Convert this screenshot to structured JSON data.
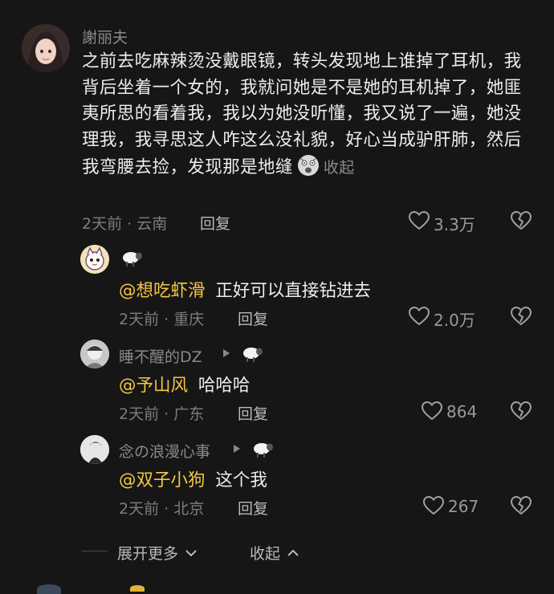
{
  "main_comment": {
    "author": "謝丽夫",
    "text": "之前去吃麻辣烫没戴眼镜，转头发现地上谁掉了耳机，我背后坐着一个女的，我就问她是不是她的耳机掉了，她匪夷所思的看着我，我以为她没听懂，我又说了一遍，她没理我，我寻思这人咋这么没礼貌，好心当成驴肝肺，然后我弯腰去捡，发现那是地缝",
    "collapse_label": "收起",
    "time_location": "2天前 · 云南",
    "reply_label": "回复",
    "likes": "3.3万",
    "emoji_icon": "shocked-face-icon"
  },
  "replies": [
    {
      "author": "",
      "badge_icon": "sheep-icon",
      "show_arrow": false,
      "mention": "@想吃虾滑",
      "text": "正好可以直接钻进去",
      "time_location": "2天前 · 重庆",
      "reply_label": "回复",
      "likes": "2.0万"
    },
    {
      "author": "睡不醒的DZ",
      "badge_icon": "sheep-icon",
      "show_arrow": true,
      "mention": "@予山风",
      "text": "哈哈哈",
      "time_location": "2天前 · 广东",
      "reply_label": "回复",
      "likes": "864"
    },
    {
      "author": "念の浪漫心事",
      "badge_icon": "sheep-icon",
      "show_arrow": true,
      "mention": "@双子小狗",
      "text": "这个我",
      "time_location": "2天前 · 北京",
      "reply_label": "回复",
      "likes": "267"
    }
  ],
  "footer": {
    "expand_more": "展开更多",
    "collapse": "收起"
  },
  "colors": {
    "background": "#161616",
    "mention": "#f3c745",
    "text": "#ededed",
    "meta": "#7d7d7d"
  }
}
